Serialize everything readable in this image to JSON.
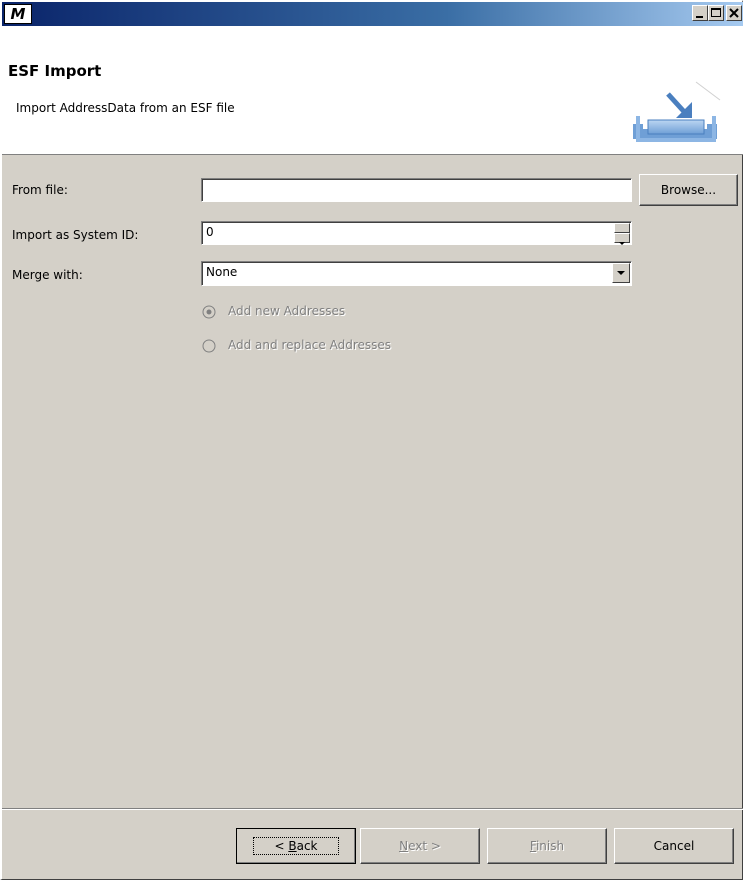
{
  "window": {
    "app_icon_letter": "M",
    "title": ""
  },
  "header": {
    "title": "ESF Import",
    "description": "Import AddressData from an ESF file",
    "icon": "import-tray-icon"
  },
  "form": {
    "from_file": {
      "label": "From file:",
      "value": "",
      "browse_label": "Browse..."
    },
    "system_id": {
      "label": "Import as System ID:",
      "value": "0"
    },
    "merge_with": {
      "label": "Merge with:",
      "selected": "None"
    },
    "options": [
      {
        "label": "Add new Addresses",
        "checked": true,
        "enabled": false
      },
      {
        "label": "Add and replace Addresses",
        "checked": false,
        "enabled": false
      }
    ]
  },
  "footer": {
    "back_prefix": "< ",
    "back_mnemonic": "B",
    "back_rest": "ack",
    "next_mnemonic": "N",
    "next_rest": "ext >",
    "finish_mnemonic": "F",
    "finish_rest": "inish",
    "cancel_label": "Cancel"
  },
  "colors": {
    "titlebar_start": "#0a246a",
    "titlebar_end": "#a6caf0",
    "dialog_bg": "#d4d0c8",
    "icon_blue": "#5a8fc8"
  }
}
